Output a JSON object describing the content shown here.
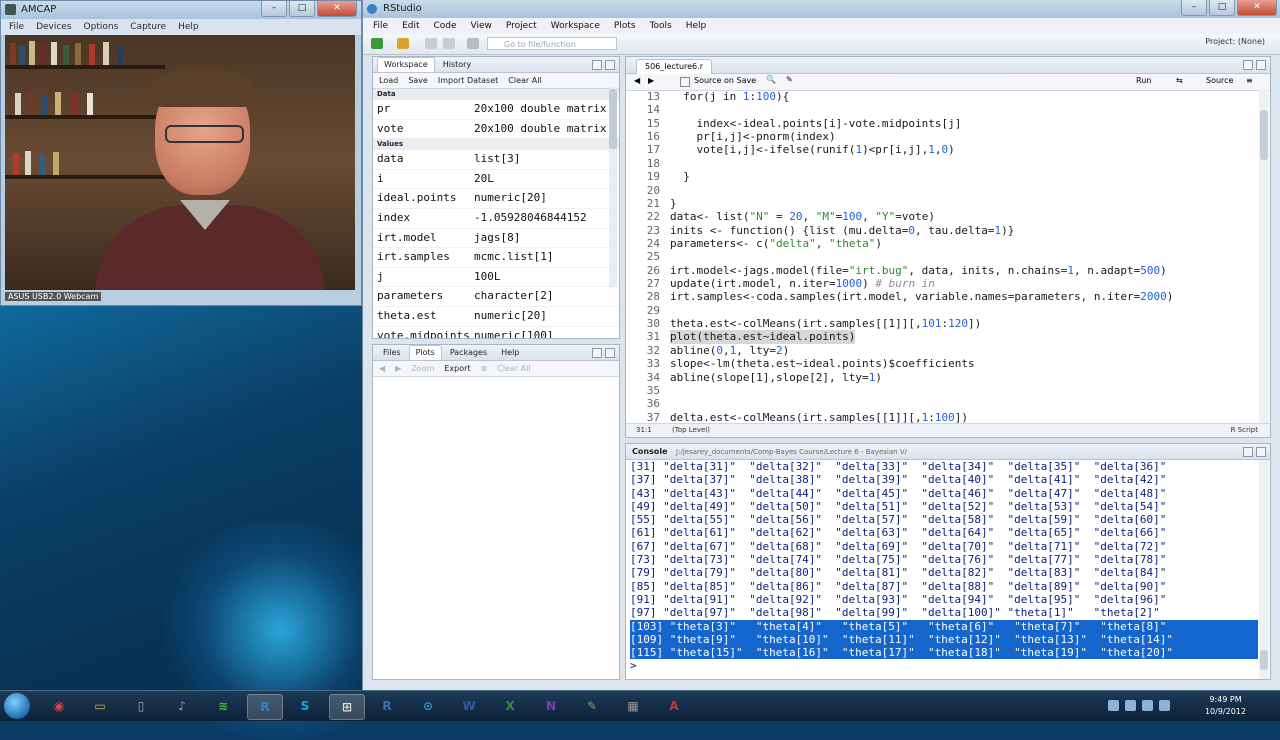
{
  "amcap": {
    "title": "AMCAP",
    "menu": [
      "File",
      "Devices",
      "Options",
      "Capture",
      "Help"
    ],
    "webcam_label": "ASUS USB2.0 Webcam"
  },
  "window_controls": {
    "minimize": "–",
    "maximize": "□",
    "close": "✕"
  },
  "rstudio": {
    "title": "RStudio",
    "menu": [
      "File",
      "Edit",
      "Code",
      "View",
      "Project",
      "Workspace",
      "Plots",
      "Tools",
      "Help"
    ],
    "goto_placeholder": "Go to file/function",
    "project": "Project: (None)"
  },
  "workspace": {
    "tabs": [
      "Workspace",
      "History"
    ],
    "tools": [
      "Load",
      "Save",
      "Import Dataset",
      "Clear All"
    ],
    "data_header": "Data",
    "values_header": "Values",
    "data": [
      {
        "name": "pr",
        "value": "20x100 double matrix"
      },
      {
        "name": "vote",
        "value": "20x100 double matrix"
      }
    ],
    "values": [
      {
        "name": "data",
        "value": "list[3]"
      },
      {
        "name": "i",
        "value": "20L"
      },
      {
        "name": "ideal.points",
        "value": "numeric[20]"
      },
      {
        "name": "index",
        "value": "-1.05928046844152"
      },
      {
        "name": "irt.model",
        "value": "jags[8]"
      },
      {
        "name": "irt.samples",
        "value": "mcmc.list[1]"
      },
      {
        "name": "j",
        "value": "100L"
      },
      {
        "name": "parameters",
        "value": "character[2]"
      },
      {
        "name": "theta.est",
        "value": "numeric[20]"
      },
      {
        "name": "vote.midpoints",
        "value": "numeric[100]"
      }
    ]
  },
  "files_pane": {
    "tabs": [
      "Files",
      "Plots",
      "Packages",
      "Help"
    ],
    "tools": [
      "Zoom",
      "Export",
      "Clear All"
    ]
  },
  "editor": {
    "tab": "506_lecture6.r",
    "source_on_save": "Source on Save",
    "run": "Run",
    "source": "Source",
    "status_pos": "31:1",
    "status_level": "(Top Level)",
    "status_type": "R Script",
    "lines": [
      {
        "n": "13",
        "code": "  for(j in 1:100){"
      },
      {
        "n": "14",
        "code": ""
      },
      {
        "n": "15",
        "code": "    index<-ideal.points[i]-vote.midpoints[j]"
      },
      {
        "n": "16",
        "code": "    pr[i,j]<-pnorm(index)"
      },
      {
        "n": "17",
        "code": "    vote[i,j]<-ifelse(runif(1)<pr[i,j],1,0)"
      },
      {
        "n": "18",
        "code": ""
      },
      {
        "n": "19",
        "code": "  }"
      },
      {
        "n": "20",
        "code": ""
      },
      {
        "n": "21",
        "code": "}"
      },
      {
        "n": "22",
        "code": "data<- list(\"N\" = 20, \"M\"=100, \"Y\"=vote)"
      },
      {
        "n": "23",
        "code": "inits <- function() {list (mu.delta=0, tau.delta=1)}"
      },
      {
        "n": "24",
        "code": "parameters<- c(\"delta\", \"theta\")"
      },
      {
        "n": "25",
        "code": ""
      },
      {
        "n": "26",
        "code": "irt.model<-jags.model(file=\"irt.bug\", data, inits, n.chains=1, n.adapt=500)"
      },
      {
        "n": "27",
        "code": "update(irt.model, n.iter=1000) # burn in"
      },
      {
        "n": "28",
        "code": "irt.samples<-coda.samples(irt.model, variable.names=parameters, n.iter=2000)"
      },
      {
        "n": "29",
        "code": ""
      },
      {
        "n": "30",
        "code": "theta.est<-colMeans(irt.samples[[1]][,101:120])"
      },
      {
        "n": "31",
        "code": "plot(theta.est~ideal.points)"
      },
      {
        "n": "32",
        "code": "abline(0,1, lty=2)"
      },
      {
        "n": "33",
        "code": "slope<-lm(theta.est~ideal.points)$coefficients"
      },
      {
        "n": "34",
        "code": "abline(slope[1],slope[2], lty=1)"
      },
      {
        "n": "35",
        "code": ""
      },
      {
        "n": "36",
        "code": ""
      },
      {
        "n": "37",
        "code": "delta.est<-colMeans(irt.samples[[1]][,1:100])"
      }
    ]
  },
  "console": {
    "title": "Console",
    "path": "J:/jesarey_documents/Comp-Bayes Course/Lecture 6 - Bayesian V/",
    "rows": [
      "[31] \"delta[31]\"  \"delta[32]\"  \"delta[33]\"  \"delta[34]\"  \"delta[35]\"  \"delta[36]\"",
      "[37] \"delta[37]\"  \"delta[38]\"  \"delta[39]\"  \"delta[40]\"  \"delta[41]\"  \"delta[42]\"",
      "[43] \"delta[43]\"  \"delta[44]\"  \"delta[45]\"  \"delta[46]\"  \"delta[47]\"  \"delta[48]\"",
      "[49] \"delta[49]\"  \"delta[50]\"  \"delta[51]\"  \"delta[52]\"  \"delta[53]\"  \"delta[54]\"",
      "[55] \"delta[55]\"  \"delta[56]\"  \"delta[57]\"  \"delta[58]\"  \"delta[59]\"  \"delta[60]\"",
      "[61] \"delta[61]\"  \"delta[62]\"  \"delta[63]\"  \"delta[64]\"  \"delta[65]\"  \"delta[66]\"",
      "[67] \"delta[67]\"  \"delta[68]\"  \"delta[69]\"  \"delta[70]\"  \"delta[71]\"  \"delta[72]\"",
      "[73] \"delta[73]\"  \"delta[74]\"  \"delta[75]\"  \"delta[76]\"  \"delta[77]\"  \"delta[78]\"",
      "[79] \"delta[79]\"  \"delta[80]\"  \"delta[81]\"  \"delta[82]\"  \"delta[83]\"  \"delta[84]\"",
      "[85] \"delta[85]\"  \"delta[86]\"  \"delta[87]\"  \"delta[88]\"  \"delta[89]\"  \"delta[90]\"",
      "[91] \"delta[91]\"  \"delta[92]\"  \"delta[93]\"  \"delta[94]\"  \"delta[95]\"  \"delta[96]\"",
      "[97] \"delta[97]\"  \"delta[98]\"  \"delta[99]\"  \"delta[100]\" \"theta[1]\"   \"theta[2]\""
    ],
    "selected_rows": [
      "[103] \"theta[3]\"   \"theta[4]\"   \"theta[5]\"   \"theta[6]\"   \"theta[7]\"   \"theta[8]\"",
      "[109] \"theta[9]\"   \"theta[10]\"  \"theta[11]\"  \"theta[12]\"  \"theta[13]\"  \"theta[14]\"",
      "[115] \"theta[15]\"  \"theta[16]\"  \"theta[17]\"  \"theta[18]\"  \"theta[19]\"  \"theta[20]\""
    ],
    "prompt": ">"
  },
  "taskbar": {
    "items": [
      "chrome-icon",
      "folder-icon",
      "files-icon",
      "media-icon",
      "spotify-icon",
      "rstudio-icon",
      "skype-icon",
      "windows-icon",
      "r-icon",
      "itunes-icon",
      "word-icon",
      "excel-icon",
      "onenote-icon",
      "editor-icon",
      "calculator-icon",
      "acrobat-icon"
    ],
    "time": "9:49 PM",
    "date": "10/9/2012"
  },
  "colors": {
    "selection": "#1465cc",
    "console_text": "#0a1f7a",
    "code_number": "#1f5ee0",
    "code_string": "#2a8a2a",
    "code_comment": "#8f8f8f"
  }
}
